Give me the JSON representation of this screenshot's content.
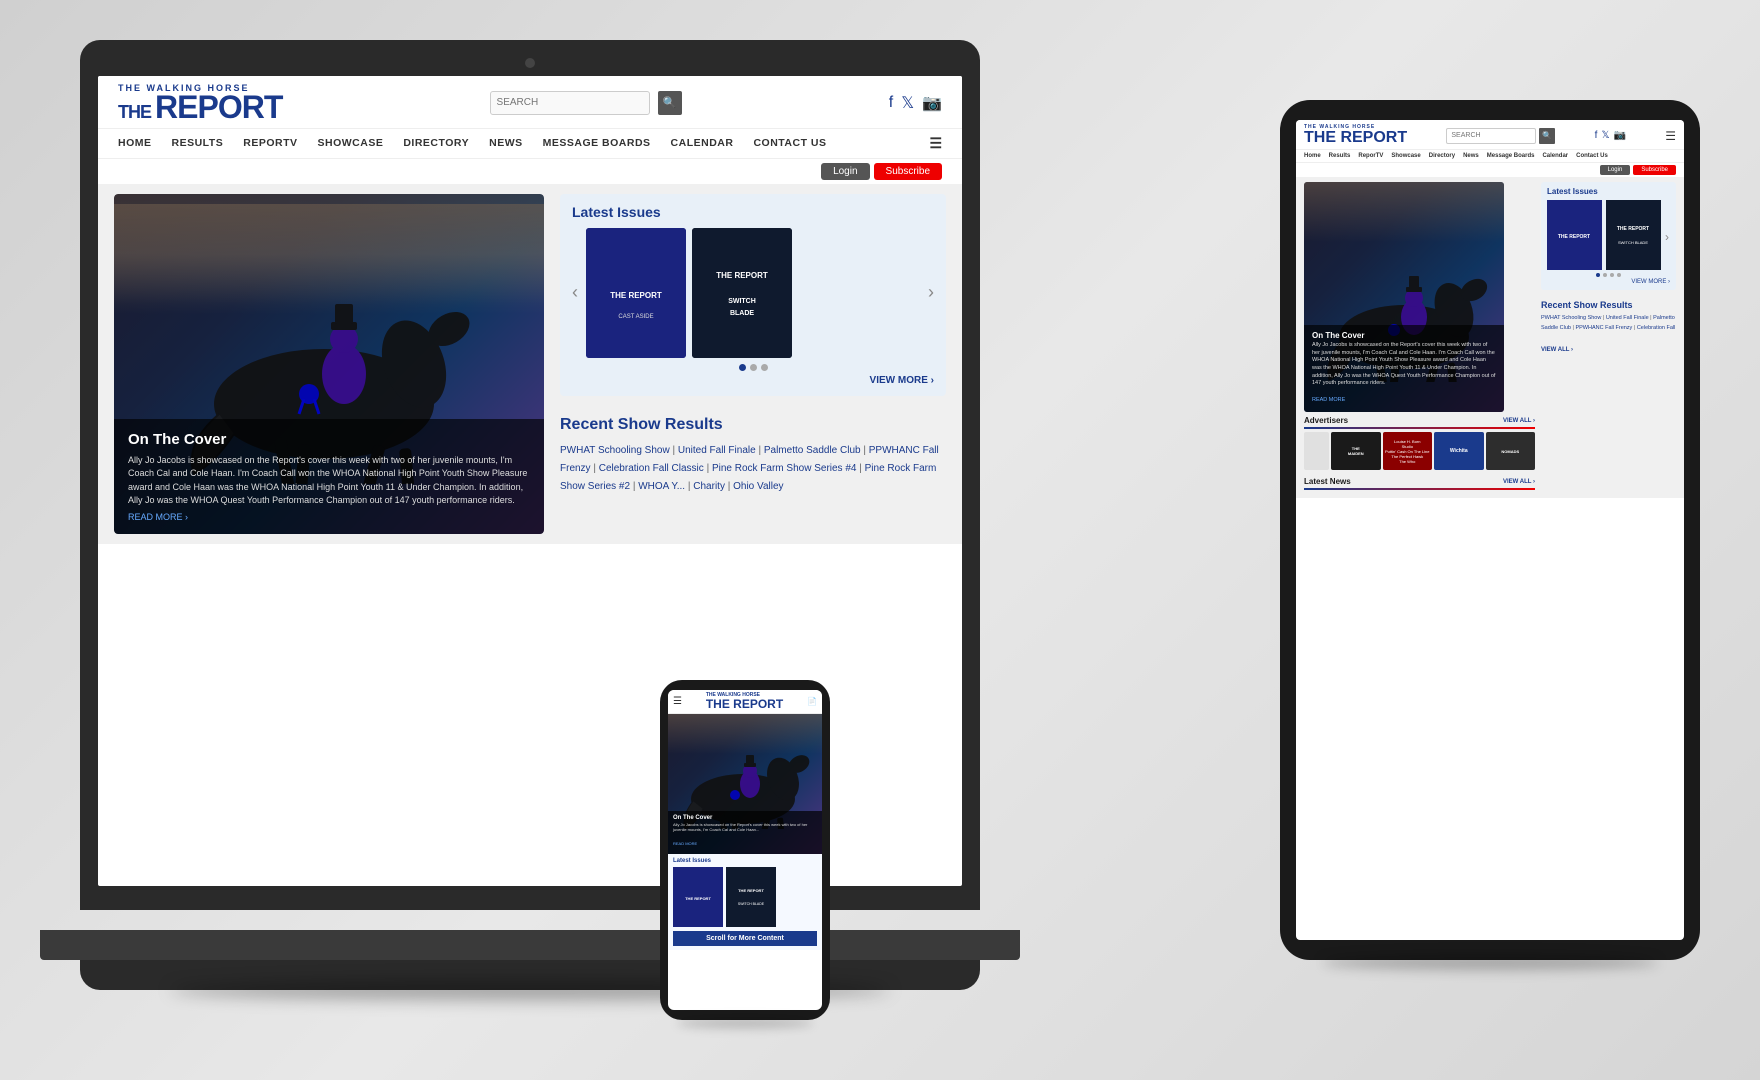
{
  "scene": {
    "background": "#e0e0e0"
  },
  "site": {
    "logo": {
      "prefix": "THE WALKING HORSE",
      "main": "THE REPORT"
    },
    "nav": {
      "items": [
        "HOME",
        "RESULTS",
        "REPORTV",
        "SHOWCASE",
        "DIRECTORY",
        "NEWS",
        "MESSAGE BOARDS",
        "CALENDAR",
        "CONTACT US"
      ]
    },
    "search": {
      "placeholder": "SEARCH"
    },
    "buttons": {
      "login": "Login",
      "subscribe": "Subscribe"
    },
    "latest_issues": {
      "title": "Latest Issues",
      "view_more": "VIEW MORE ›",
      "carousel_prev": "‹",
      "carousel_next": "›",
      "covers": [
        {
          "label": "CAST ASIDE"
        },
        {
          "label": "SWITCH BLADE"
        }
      ]
    },
    "cover_story": {
      "title": "On The Cover",
      "text": "Ally Jo Jacobs is showcased on the Report's cover this week with two of her juvenile mounts, I'm Coach Cal and Cole Haan. I'm Coach Call won the WHOA National High Point Youth Show Pleasure award and Cole Haan was the WHOA National High Point Youth 11 & Under Champion. In addition, Ally Jo was the WHOA Quest Youth Performance Champion out of 147 youth performance riders.",
      "read_more": "READ MORE ›"
    },
    "recent_show_results": {
      "title": "Recent Show Results",
      "tablet_title": "Recent Show Results",
      "items": [
        "PWHAT Schooling Show",
        "United Fall Finale",
        "Palmetto Saddle Club",
        "PPWHANC Fall Frenzy",
        "Celebration Fall Classic",
        "Pine Rock Farm Show Series #4",
        "Pine Rock Farm Show Series #2",
        "WHOA Y...",
        "Charity",
        "Ohio Valley"
      ],
      "tablet_items": [
        "PWHAT Schooling Show",
        "United Fall Finale",
        "Palmetto Saddle Club",
        "PPWHANC Fall Frenzy",
        "Celebration Fall"
      ],
      "view_all": "VIEW ALL ›"
    },
    "advertisers": {
      "title": "Advertisers",
      "view_all": "VIEW ALL ›",
      "items": [
        {
          "name": "The Maiden",
          "color": "#1a1a1a"
        },
        {
          "name": "Louise H. Born",
          "color": "#8b0000"
        },
        {
          "name": "Wichita",
          "color": "#1a3a8c"
        },
        {
          "name": "Nomads",
          "color": "#2d2d2d"
        }
      ]
    },
    "latest_news": {
      "title": "Latest News",
      "view_all": "VIEW ALL ›"
    },
    "phone": {
      "scroll_btn": "Scroll for More Content"
    },
    "dots": [
      "●",
      "●",
      "●"
    ]
  }
}
